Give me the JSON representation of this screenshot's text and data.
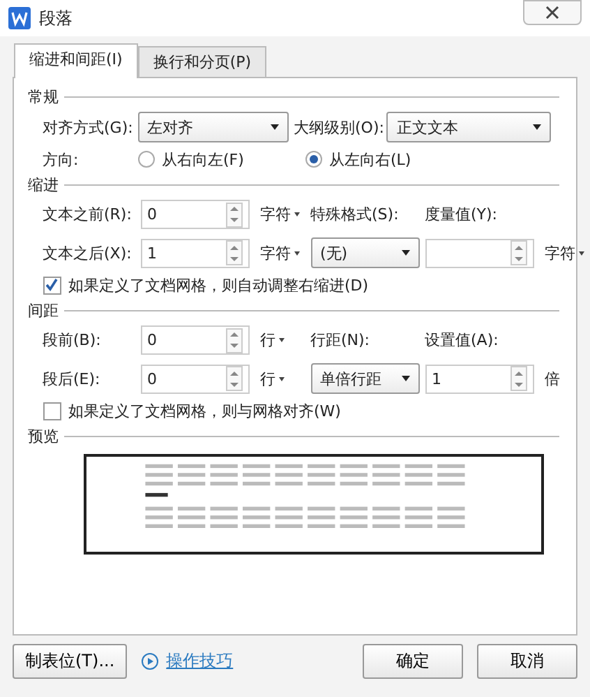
{
  "window": {
    "title": "段落"
  },
  "tabs": [
    {
      "label": "缩进和间距(I)",
      "selected": true
    },
    {
      "label": "换行和分页(P)",
      "selected": false
    }
  ],
  "general": {
    "title": "常规",
    "alignment": {
      "label": "对齐方式(G):",
      "value": "左对齐"
    },
    "outline_level": {
      "label": "大纲级别(O):",
      "value": "正文文本"
    },
    "direction": {
      "label": "方向:",
      "options": [
        {
          "label": "从右向左(F)",
          "selected": false
        },
        {
          "label": "从左向右(L)",
          "selected": true
        }
      ]
    }
  },
  "indent": {
    "title": "缩进",
    "before": {
      "label": "文本之前(R):",
      "value": "0",
      "unit": "字符",
      "unit_menu": true
    },
    "after": {
      "label": "文本之后(X):",
      "value": "1",
      "unit": "字符",
      "unit_menu": true
    },
    "special": {
      "label": "特殊格式(S):",
      "value": "(无)"
    },
    "measure": {
      "label": "度量值(Y):",
      "unit": "字符",
      "unit_menu": true
    },
    "auto_adjust": {
      "label": "如果定义了文档网格，则自动调整右缩进(D)",
      "checked": true
    }
  },
  "spacing": {
    "title": "间距",
    "before": {
      "label": "段前(B):",
      "value": "0",
      "unit": "行",
      "unit_menu": true
    },
    "after": {
      "label": "段后(E):",
      "value": "0",
      "unit": "行",
      "unit_menu": true
    },
    "line_spacing": {
      "label": "行距(N):",
      "value": "单倍行距"
    },
    "set_value": {
      "label": "设置值(A):",
      "value": "1",
      "unit": "倍",
      "unit_menu": false
    },
    "snap_to_grid": {
      "label": "如果定义了文档网格，则与网格对齐(W)",
      "checked": false
    }
  },
  "preview": {
    "title": "预览"
  },
  "footer": {
    "tabs_button": "制表位(T)...",
    "tips_link": "操作技巧",
    "ok_button": "确定",
    "cancel_button": "取消"
  }
}
